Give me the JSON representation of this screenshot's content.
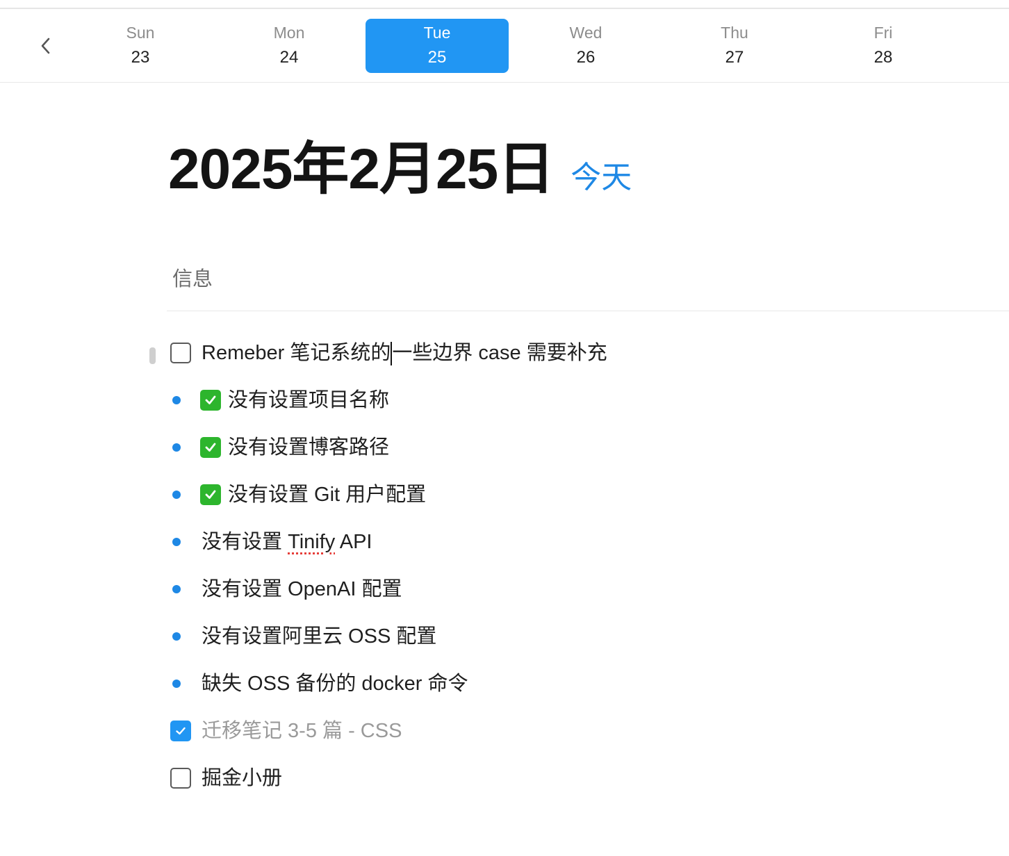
{
  "week": {
    "days": [
      {
        "name": "Sun",
        "num": "23"
      },
      {
        "name": "Mon",
        "num": "24"
      },
      {
        "name": "Tue",
        "num": "25"
      },
      {
        "name": "Wed",
        "num": "26"
      },
      {
        "name": "Thu",
        "num": "27"
      },
      {
        "name": "Fri",
        "num": "28"
      }
    ],
    "selected": "Tue",
    "accent": "#2196f3"
  },
  "header": {
    "date_title": "2025年2月25日",
    "today_label": "今天"
  },
  "section": {
    "title": "信息"
  },
  "items": [
    {
      "type": "checkbox",
      "checked": false,
      "text_a": "Remeber 笔记系统的",
      "text_b": "一些边界 case 需要补充"
    },
    {
      "type": "bullet",
      "emoji": "check-mark-button",
      "text": "没有设置项目名称"
    },
    {
      "type": "bullet",
      "emoji": "check-mark-button",
      "text": "没有设置博客路径"
    },
    {
      "type": "bullet",
      "emoji": "check-mark-button",
      "text": "没有设置 Git 用户配置"
    },
    {
      "type": "bullet",
      "text_a": "没有设置 ",
      "text_spell": "Tinify",
      "text_b": " API"
    },
    {
      "type": "bullet",
      "text": "没有设置 OpenAI 配置"
    },
    {
      "type": "bullet",
      "text": "没有设置阿里云 OSS 配置"
    },
    {
      "type": "bullet",
      "text": "缺失 OSS 备份的 docker 命令"
    },
    {
      "type": "checkbox",
      "checked": true,
      "text": "迁移笔记 3-5 篇 - CSS"
    },
    {
      "type": "checkbox",
      "checked": false,
      "text": "掘金小册"
    }
  ]
}
